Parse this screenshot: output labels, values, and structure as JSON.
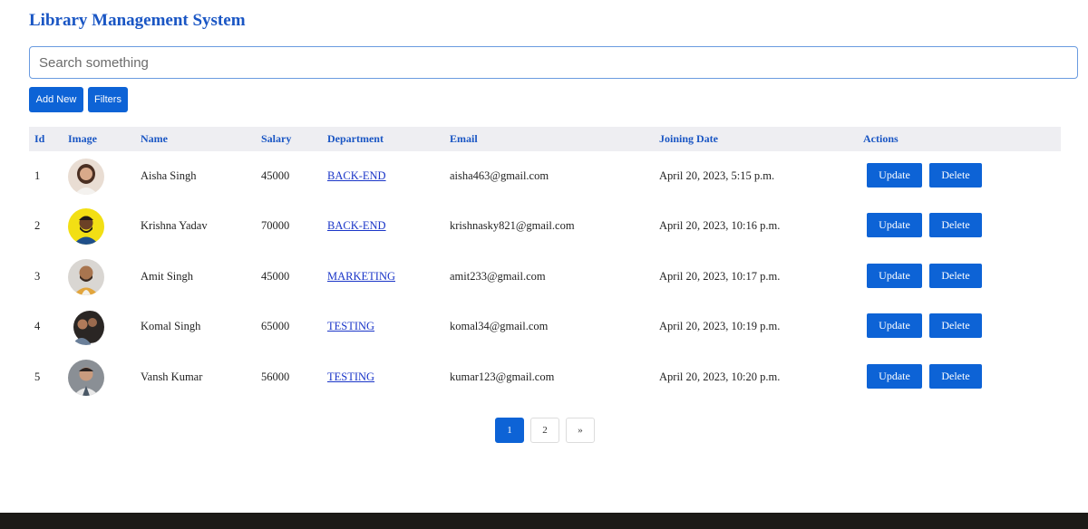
{
  "page": {
    "title": "Library Management System"
  },
  "search": {
    "placeholder": "Search something"
  },
  "toolbar": {
    "add_new_label": "Add New",
    "filters_label": "Filters"
  },
  "table": {
    "headers": [
      "Id",
      "Image",
      "Name",
      "Salary",
      "Department",
      "Email",
      "Joining Date",
      "Actions"
    ],
    "rows": [
      {
        "id": "1",
        "name": "Aisha Singh",
        "salary": "45000",
        "department": "BACK-END",
        "email": "aisha463@gmail.com",
        "joining_date": "April 20, 2023, 5:15 p.m.",
        "avatar_bg": "#e9ddd3"
      },
      {
        "id": "2",
        "name": "Krishna Yadav",
        "salary": "70000",
        "department": "BACK-END",
        "email": "krishnasky821@gmail.com",
        "joining_date": "April 20, 2023, 10:16 p.m.",
        "avatar_bg": "#f2df14"
      },
      {
        "id": "3",
        "name": "Amit Singh",
        "salary": "45000",
        "department": "MARKETING",
        "email": "amit233@gmail.com",
        "joining_date": "April 20, 2023, 10:17 p.m.",
        "avatar_bg": "#d9d6d2"
      },
      {
        "id": "4",
        "name": "Komal Singh",
        "salary": "65000",
        "department": "TESTING",
        "email": "komal34@gmail.com",
        "joining_date": "April 20, 2023, 10:19 p.m.",
        "avatar_bg": "#ffffff"
      },
      {
        "id": "5",
        "name": "Vansh Kumar",
        "salary": "56000",
        "department": "TESTING",
        "email": "kumar123@gmail.com",
        "joining_date": "April 20, 2023, 10:20 p.m.",
        "avatar_bg": "#8a8f95"
      }
    ],
    "update_label": "Update",
    "delete_label": "Delete"
  },
  "pagination": {
    "pages": [
      "1",
      "2"
    ],
    "next_label": "»",
    "current": "1"
  },
  "colors": {
    "accent": "#0d63d6",
    "heading": "#1a56c4",
    "link": "#1a35c8",
    "footer": "#1c1a17"
  }
}
